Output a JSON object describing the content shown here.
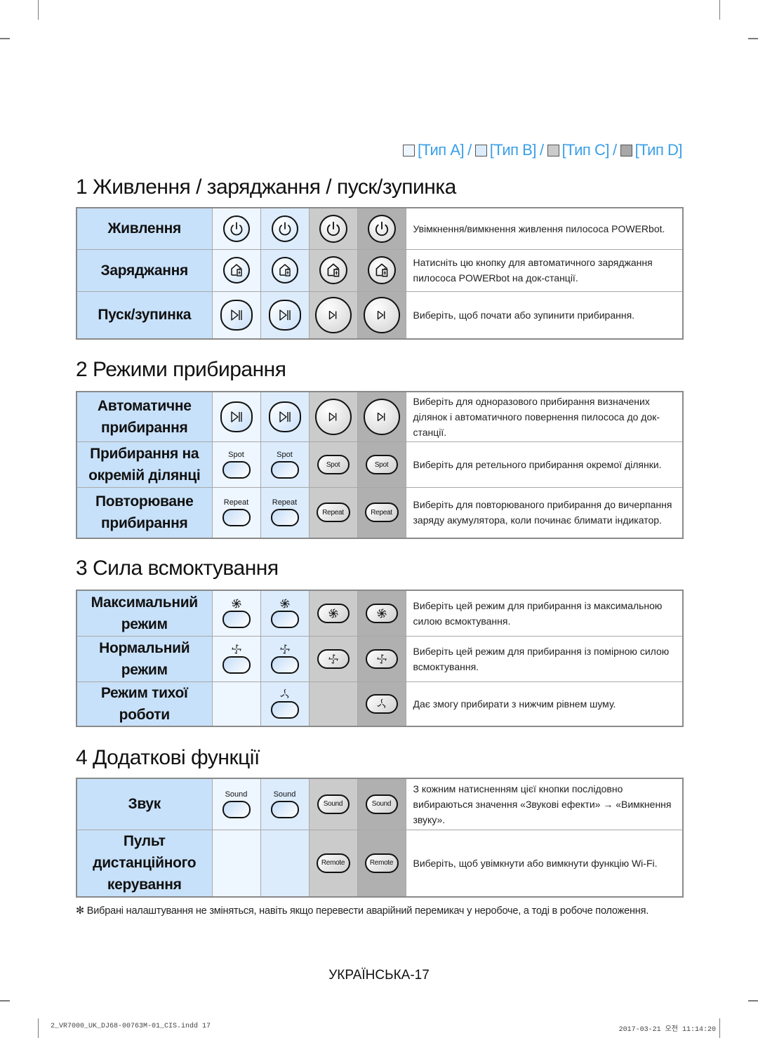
{
  "legend": {
    "items": [
      {
        "label": "[Тип A]",
        "color": "#eef6ff"
      },
      {
        "label": "[Тип B]",
        "color": "#dcecfd"
      },
      {
        "label": "[Тип C]",
        "color": "#cbcbcb"
      },
      {
        "label": "[Тип D]",
        "color": "#a8a8a8"
      }
    ],
    "separator": "/",
    "text_color": "#3aa0e8"
  },
  "sections": [
    {
      "title": "1 Живлення / заряджання / пуск/зупинка",
      "rows": [
        {
          "label": "Живлення",
          "icon": "power-icon",
          "description": "Увімкнення/вимкнення живлення пилососа POWERbot."
        },
        {
          "label": "Заряджання",
          "icon": "home-charge-icon",
          "description": "Натисніть цю кнопку для автоматичного заряджання пилососа POWERbot на док-станції."
        },
        {
          "label": "Пуск/зупинка",
          "icon": "play-pause-icon",
          "description": "Виберіть, щоб почати або зупинити прибирання."
        }
      ]
    },
    {
      "title": "2 Режими прибирання",
      "rows": [
        {
          "label": "Автоматичне прибирання",
          "icon": "play-pause-icon",
          "description": "Виберіть для одноразового прибирання визначених ділянок і автоматичного повернення пилососа до док-станції."
        },
        {
          "label": "Прибирання на окремій ділянці",
          "icon": "spot-button",
          "button_text": "Spot",
          "description": "Виберіть для ретельного прибирання окремої ділянки."
        },
        {
          "label": "Повторюване прибирання",
          "icon": "repeat-button",
          "button_text": "Repeat",
          "description": "Виберіть для повторюваного прибирання до вичерпання заряду акумулятора, коли починає блимати індикатор."
        }
      ]
    },
    {
      "title": "3 Сила всмоктування",
      "rows": [
        {
          "label": "Максимальний режим",
          "icon": "fan-max-icon",
          "description": "Виберіть цей режим для прибирання із максимальною силою всмоктування."
        },
        {
          "label": "Нормальний режим",
          "icon": "fan-normal-icon",
          "description": "Виберіть цей режим для прибирання із помірною силою всмоктування."
        },
        {
          "label": "Режим тихої роботи",
          "icon": "fan-quiet-icon",
          "description": "Дає змогу прибирати з нижчим рівнем шуму."
        }
      ]
    },
    {
      "title": "4 Додаткові функції",
      "rows": [
        {
          "label": "Звук",
          "icon": "sound-button",
          "button_text": "Sound",
          "description": "З кожним натисненням цієї кнопки послідовно вибираються значення «Звукові ефекти» → «Вимкнення звуку»."
        },
        {
          "label": "Пульт дистанційного керування",
          "icon": "remote-button",
          "button_text": "Remote",
          "description": "Виберіть, щоб увімкнути або вимкнути функцію Wi-Fi."
        }
      ]
    }
  ],
  "note": "✻ Вибрані налаштування не зміняться, навіть якщо перевести аварійний перемикач у неробоче, а тоді в робоче положення.",
  "page_number": "УКРАЇНСЬКА-17",
  "footer": {
    "file": "2_VR7000_UK_DJ68-00763M-01_CIS.indd   17",
    "timestamp": "2017-03-21   오전 11:14:20"
  }
}
